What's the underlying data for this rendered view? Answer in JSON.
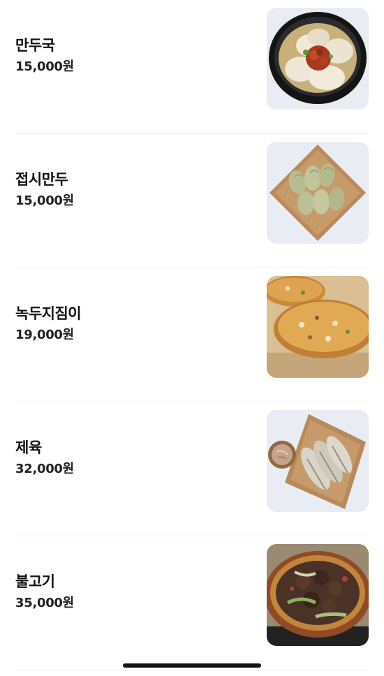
{
  "menu": {
    "items": [
      {
        "name": "만두국",
        "price": "15,000원",
        "image": "dumpling-soup"
      },
      {
        "name": "접시만두",
        "price": "15,000원",
        "image": "plate-dumplings"
      },
      {
        "name": "녹두지짐이",
        "price": "19,000원",
        "image": "mung-bean-pancake"
      },
      {
        "name": "제육",
        "price": "32,000원",
        "image": "sliced-pork"
      },
      {
        "name": "불고기",
        "price": "35,000원",
        "image": "bulgogi-hotpot"
      }
    ]
  },
  "colors": {
    "background": "#ffffff",
    "text": "#111111",
    "thumbnail_bg": "#e9edf3",
    "divider": "#eeeeee"
  }
}
